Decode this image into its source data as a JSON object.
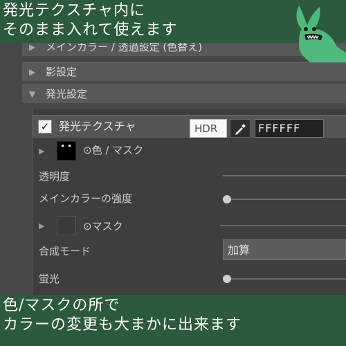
{
  "captions": {
    "top_line1": "発光テクスチャ内に",
    "top_line2": "そのまま入れて使えます",
    "bottom_line1": "色/マスクの所で",
    "bottom_line2": "カラーの変更も大まかに出来ます"
  },
  "sections": [
    {
      "label": "メインカラー / 透過設定 (色替え)",
      "expanded": false
    },
    {
      "label": "影設定",
      "expanded": false
    },
    {
      "label": "発光設定",
      "expanded": true
    }
  ],
  "emission": {
    "header_label": "発光テクスチャ",
    "header_checked": true,
    "color_mask_label": "⊙色 / マスク",
    "hdr_label": "HDR",
    "color_hex": "FFFFFF",
    "transparency_label": "透明度",
    "main_color_strength_label": "メインカラーの強度",
    "mask_label": "⊙マスク",
    "blend_mode_label": "合成モード",
    "blend_mode_value": "加算",
    "fluorescence_label": "蛍光"
  },
  "colors": {
    "background": "#2c5a3d",
    "panel": "#474747",
    "mascot": "#4db97b"
  },
  "icons": {
    "expand": "triangle-right",
    "collapse": "triangle-down",
    "dropper": "eyedropper"
  }
}
